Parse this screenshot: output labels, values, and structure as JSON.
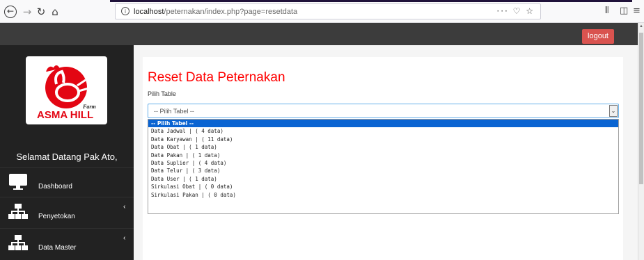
{
  "browser": {
    "url_host": "localhost",
    "url_path": "/peternakan/index.php?page=resetdata",
    "page_actions": "··· ♡ ☆"
  },
  "header": {
    "logout_label": "logout"
  },
  "sidebar": {
    "logo_text": "ASMA HILL",
    "logo_sub": "Farm",
    "welcome": "Selamat Datang Pak Ato,",
    "items": [
      {
        "label": "Dashboard",
        "icon": "monitor-icon"
      },
      {
        "label": "Penyetokan",
        "icon": "sitemap-icon"
      },
      {
        "label": "Data Master",
        "icon": "sitemap-icon"
      }
    ]
  },
  "main": {
    "title": "Reset Data Peternakan",
    "field_label": "Pilih Table",
    "select_value": "-- Pilih Tabel --",
    "options": [
      "-- Pilih Tabel --",
      "Data Jadwal | ( 4 data)",
      "Data Karyawan | ( 11 data)",
      "Data Obat | ( 1 data)",
      "Data Pakan | ( 1 data)",
      "Data Suplier | ( 4 data)",
      "Data Telur | ( 3 data)",
      "Data User | ( 1 data)",
      "Sirkulasi Obat | ( 0 data)",
      "Sirkulasi Pakan | ( 0 data)"
    ]
  },
  "colors": {
    "title": "#ff0000",
    "logout": "#d9534f",
    "sidebar": "#222222",
    "highlight": "#0a64d2"
  }
}
